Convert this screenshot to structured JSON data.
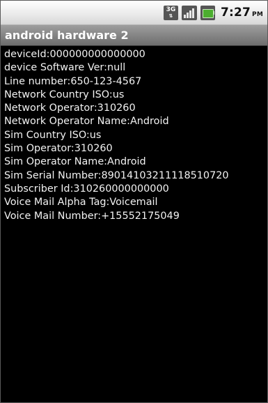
{
  "status_bar": {
    "network_label": "3G",
    "time": "7:27",
    "ampm": "PM"
  },
  "title_bar": {
    "title": "android hardware 2"
  },
  "info_rows": [
    {
      "label": "deviceId:",
      "value": "000000000000000"
    },
    {
      "label": "device Software Ver:",
      "value": "null"
    },
    {
      "label": "Line number:",
      "value": "650-123-4567"
    },
    {
      "label": "Network Country ISO:",
      "value": "us"
    },
    {
      "label": "Network Operator:",
      "value": "310260"
    },
    {
      "label": "Network Operator Name:",
      "value": "Android"
    },
    {
      "label": "Sim Country ISO:",
      "value": "us"
    },
    {
      "label": "Sim Operator:",
      "value": "310260"
    },
    {
      "label": "Sim Operator Name:",
      "value": "Android"
    },
    {
      "label": "Sim Serial Number:",
      "value": "89014103211118510720"
    },
    {
      "label": "Subscriber Id:",
      "value": "310260000000000"
    },
    {
      "label": "Voice Mail Alpha Tag:",
      "value": "Voicemail"
    },
    {
      "label": "Voice Mail Number:",
      "value": "+15552175049"
    }
  ]
}
